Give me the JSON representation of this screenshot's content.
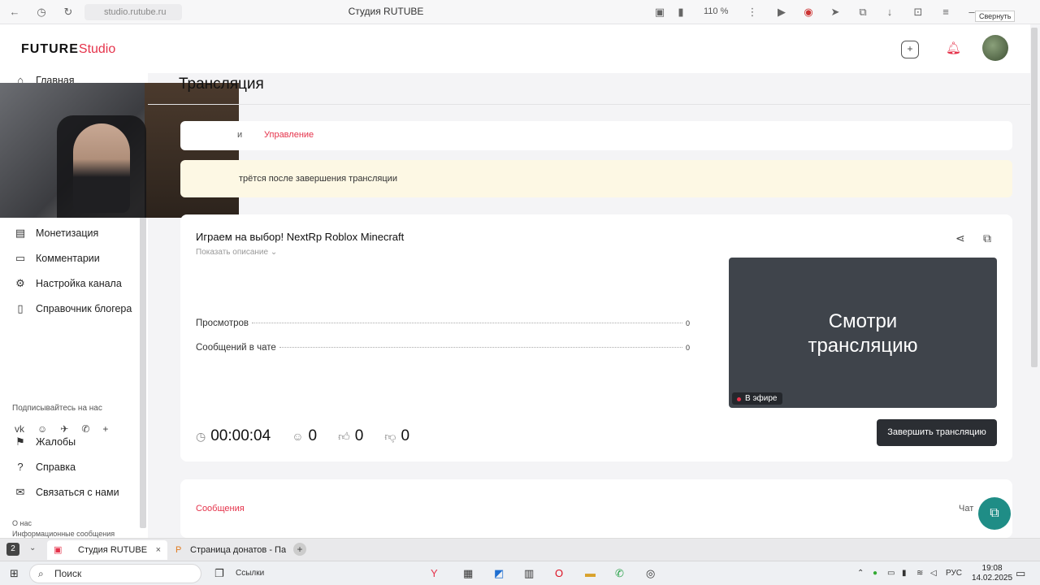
{
  "browser": {
    "url": "studio.rutube.ru",
    "title": "Студия RUTUBE",
    "zoom": "110 %",
    "tooltip": "Свернуть"
  },
  "header": {
    "logo_main": "FUTURE",
    "logo_sub": "Studio"
  },
  "sidebar": {
    "items": [
      {
        "label": "Главная",
        "icon": "home-icon"
      },
      {
        "label": "Монетизация",
        "icon": "wallet-icon"
      },
      {
        "label": "Комментарии",
        "icon": "comment-icon"
      },
      {
        "label": "Настройка канала",
        "icon": "gear-icon"
      },
      {
        "label": "Справочник блогера",
        "icon": "book-icon"
      }
    ],
    "subscribe_label": "Подписывайтесь на нас",
    "socials": [
      "vk-icon",
      "ok-icon",
      "telegram-icon",
      "viber-icon",
      "plus-icon"
    ],
    "bottom_items": [
      {
        "label": "Жалобы",
        "icon": "flag-icon"
      },
      {
        "label": "Справка",
        "icon": "help-icon"
      },
      {
        "label": "Связаться с нами",
        "icon": "mail-icon"
      }
    ],
    "about": "О нас",
    "info": "Информационные сообщения"
  },
  "main": {
    "page_title": "Трансляция",
    "tabs": [
      {
        "label": "и",
        "active": false
      },
      {
        "label": "Управление",
        "active": true
      }
    ],
    "notice": "трётся после завершения трансляции",
    "stream": {
      "title": "Играем на выбор! NextRp Roblox Minecraft",
      "show_description": "Показать описание",
      "stats": [
        {
          "label": "Просмотров",
          "value": "0"
        },
        {
          "label": "Сообщений в чате",
          "value": "0"
        }
      ],
      "preview_text_1": "Смотри",
      "preview_text_2": "трансляцию",
      "live_badge": "В эфире",
      "duration": "00:00:04",
      "viewers": "0",
      "likes": "0",
      "dislikes": "0",
      "end_button": "Завершить трансляцию"
    },
    "messages_tab": "Сообщения",
    "chat_label": "Чат"
  },
  "window_tabs": [
    {
      "label": "Студия RUTUBE",
      "active": true
    },
    {
      "label": "Страница донатов - Пане",
      "active": false
    }
  ],
  "window_tabs_badge": "2",
  "taskbar": {
    "search_placeholder": "Поиск",
    "links_label": "Ссылки",
    "lang": "РУС",
    "time": "19:08",
    "date": "14.02.2025"
  }
}
